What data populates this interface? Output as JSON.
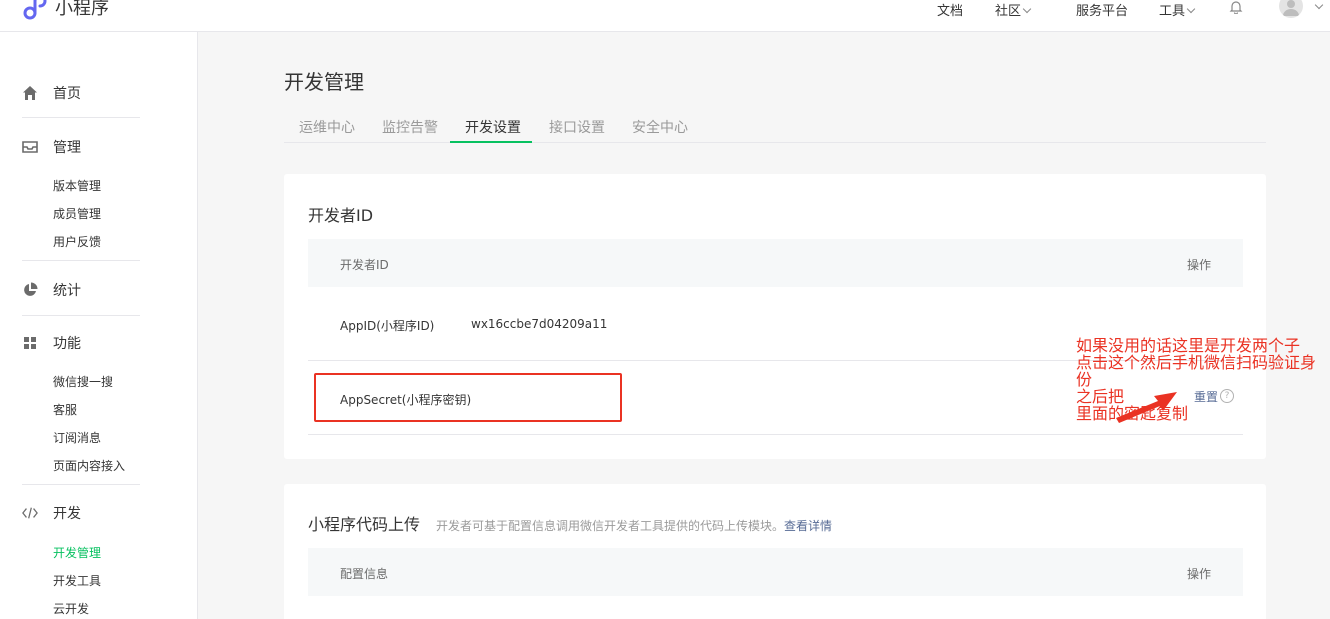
{
  "app": {
    "name": "小程序"
  },
  "topnav": {
    "items": [
      {
        "label": "文档"
      },
      {
        "label": "社区"
      },
      {
        "label": "服务平台"
      },
      {
        "label": "工具"
      }
    ]
  },
  "sidebar": {
    "groups": [
      {
        "label": "首页",
        "icon": "home-icon",
        "items": []
      },
      {
        "label": "管理",
        "icon": "inbox-icon",
        "items": [
          "版本管理",
          "成员管理",
          "用户反馈"
        ]
      },
      {
        "label": "统计",
        "icon": "pie-chart-icon",
        "items": []
      },
      {
        "label": "功能",
        "icon": "grid-icon",
        "items": [
          "微信搜一搜",
          "客服",
          "订阅消息",
          "页面内容接入"
        ]
      },
      {
        "label": "开发",
        "icon": "code-icon",
        "items": [
          "开发管理",
          "开发工具",
          "云开发"
        ]
      }
    ],
    "active_item": "开发管理"
  },
  "page": {
    "title": "开发管理",
    "tabs": [
      {
        "label": "运维中心"
      },
      {
        "label": "监控告警"
      },
      {
        "label": "开发设置",
        "active": true
      },
      {
        "label": "接口设置"
      },
      {
        "label": "安全中心"
      }
    ]
  },
  "developer_id": {
    "title": "开发者ID",
    "header": {
      "col1": "开发者ID",
      "col2": "操作"
    },
    "rows": [
      {
        "key": "AppID(小程序ID)",
        "value": "wx16ccbe7d04209a11"
      },
      {
        "key": "AppSecret(小程序密钥)",
        "action": "重置",
        "help": "?"
      }
    ]
  },
  "code_upload": {
    "title": "小程序代码上传",
    "description": "开发者可基于配置信息调用微信开发者工具提供的代码上传模块。",
    "link": "查看详情",
    "header": {
      "col1": "配置信息",
      "col2": "操作"
    }
  },
  "annotation": {
    "text": "如果没用的话这里是开发两个子\n点击这个然后手机微信扫码验证身\n份\n之后把\n里面的密匙复制",
    "color": "#ea3223"
  },
  "colors": {
    "accent": "#07c160",
    "link": "#576b95",
    "annotation": "#ea3223"
  }
}
